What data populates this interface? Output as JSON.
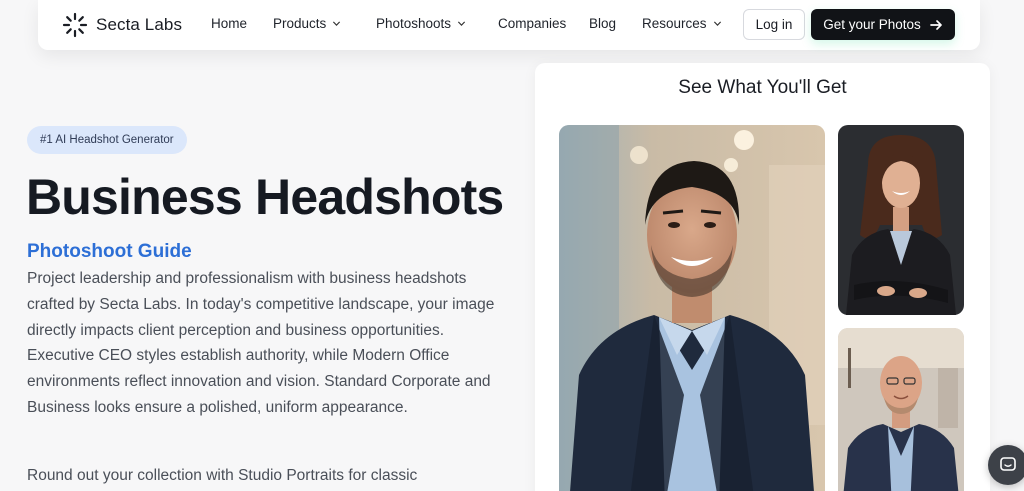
{
  "nav": {
    "logo_text": "Secta Labs",
    "links": [
      {
        "label": "Home"
      },
      {
        "label": "Products"
      },
      {
        "label": "Photoshoots"
      },
      {
        "label": "Companies"
      },
      {
        "label": "Blog"
      },
      {
        "label": "Resources"
      }
    ],
    "login_label": "Log in",
    "cta_label": "Get your Photos"
  },
  "hero": {
    "badge": "#1 AI Headshot Generator",
    "title": "Business Headshots",
    "guide_label": "Photoshoot Guide",
    "paragraph": "Project leadership and professionalism with business headshots crafted by Secta Labs. In today's competitive landscape, your image directly impacts client perception and business opportunities. Executive CEO styles establish authority, while Modern Office environments reflect innovation and vision. Standard Corporate and Business looks ensure a polished, uniform appearance.",
    "paragraph_2": "Round out your collection with Studio Portraits for classic"
  },
  "showcase": {
    "title": "See What You'll Get"
  },
  "colors": {
    "accent_blue": "#2d6fd6",
    "badge_bg": "#dbe7fb",
    "cta_bg": "#111317"
  },
  "icons": [
    "logo-mark-icon",
    "chevron-down-icon",
    "arrow-right-icon",
    "chat-icon"
  ]
}
